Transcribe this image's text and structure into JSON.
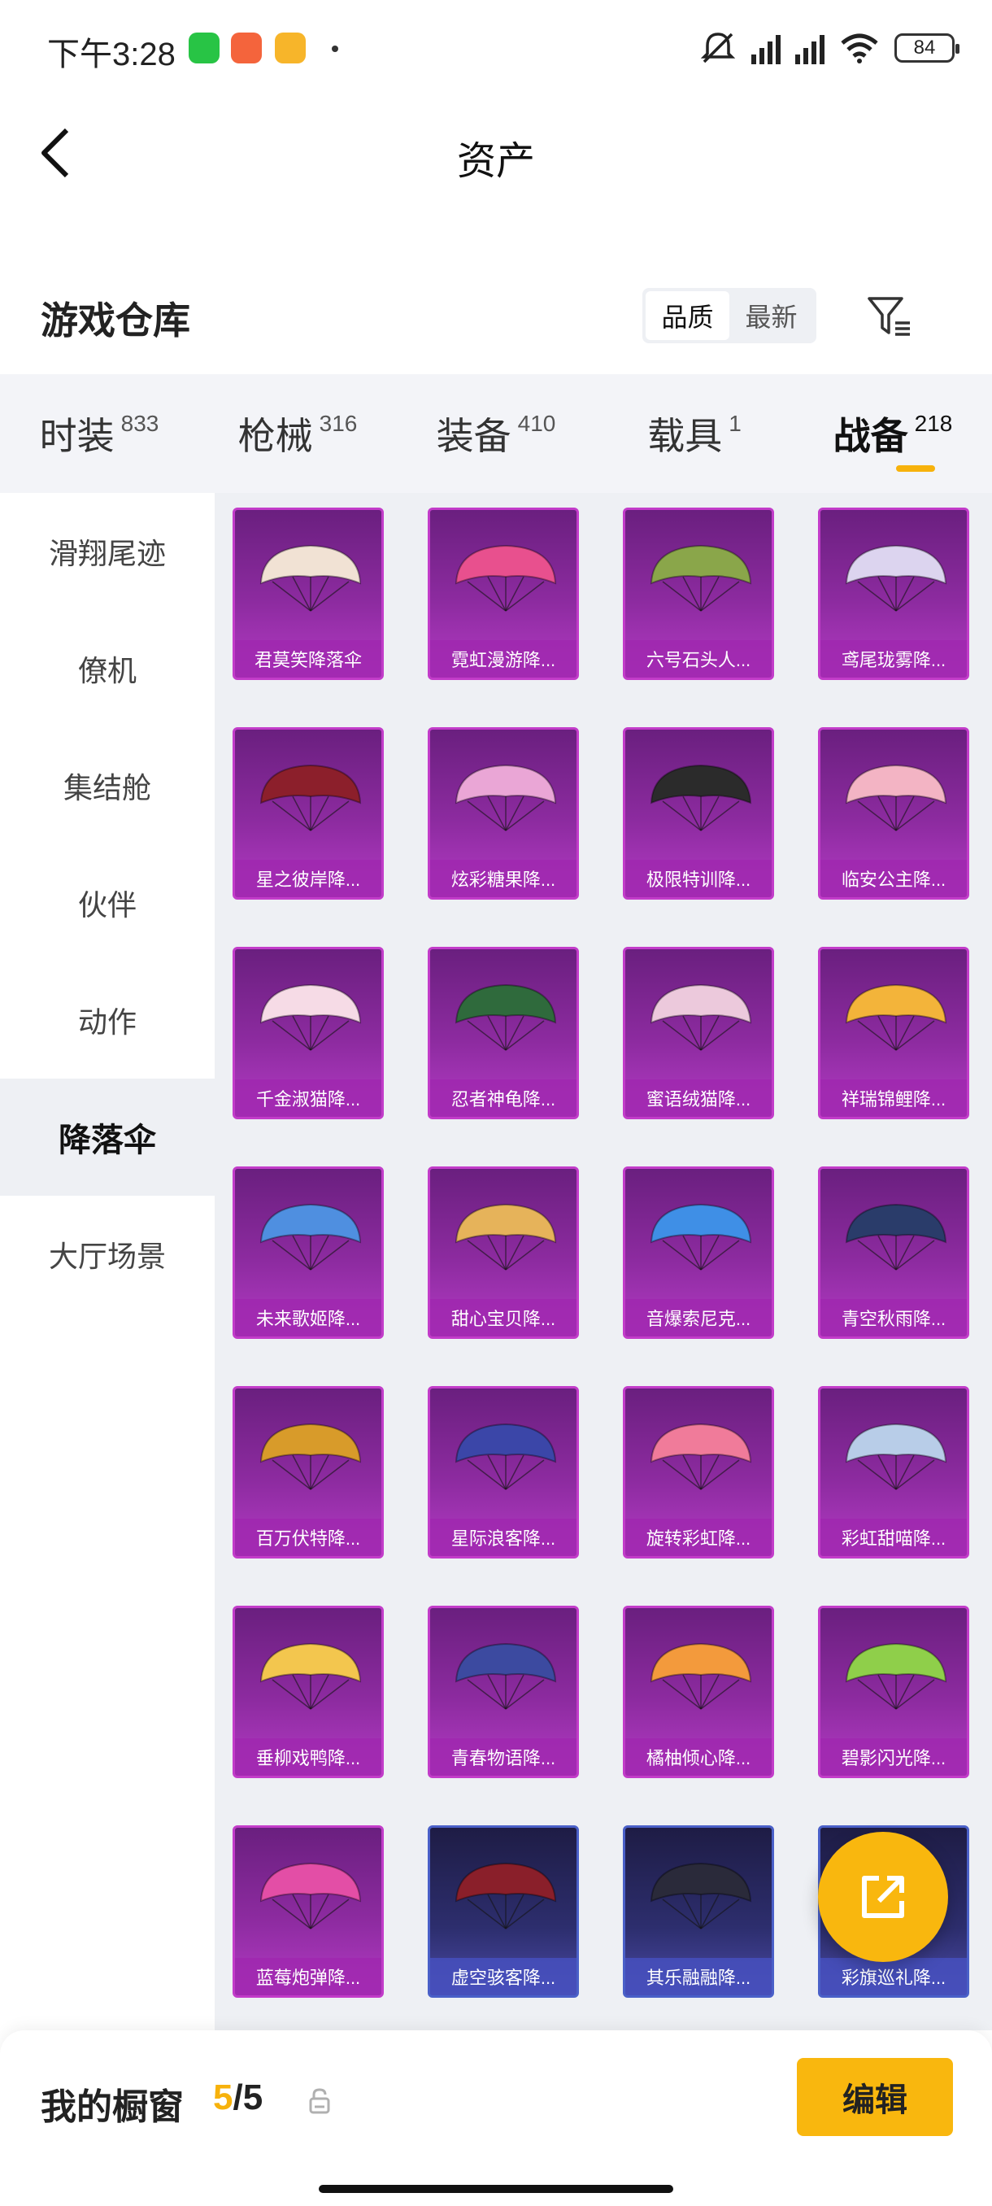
{
  "status_bar": {
    "time": "下午3:28",
    "battery": "84"
  },
  "header": {
    "title": "资产"
  },
  "section": {
    "title": "游戏仓库",
    "sort_options": [
      "品质",
      "最新"
    ],
    "active_sort": "品质"
  },
  "tabs": [
    {
      "label": "时装",
      "count": "833"
    },
    {
      "label": "枪械",
      "count": "316"
    },
    {
      "label": "装备",
      "count": "410"
    },
    {
      "label": "载具",
      "count": "1"
    },
    {
      "label": "战备",
      "count": "218",
      "active": true
    }
  ],
  "sidebar": {
    "items": [
      "滑翔尾迹",
      "僚机",
      "集结舱",
      "伙伴",
      "动作",
      "降落伞",
      "大厅场景"
    ],
    "active": "降落伞"
  },
  "items": [
    {
      "name": "君莫笑降落伞",
      "color": "#f1e2d4",
      "rarity": "purple"
    },
    {
      "name": "霓虹漫游降...",
      "color": "#e8508e",
      "rarity": "purple"
    },
    {
      "name": "六号石头人...",
      "color": "#8aa64a",
      "rarity": "purple"
    },
    {
      "name": "鸢尾珑雾降...",
      "color": "#dcd4ef",
      "rarity": "purple"
    },
    {
      "name": "星之彼岸降...",
      "color": "#8c1f2b",
      "rarity": "purple"
    },
    {
      "name": "炫彩糖果降...",
      "color": "#eaa6d6",
      "rarity": "purple"
    },
    {
      "name": "极限特训降...",
      "color": "#2b2b2b",
      "rarity": "purple"
    },
    {
      "name": "临安公主降...",
      "color": "#f3b4c4",
      "rarity": "purple"
    },
    {
      "name": "千金淑猫降...",
      "color": "#f6dbe6",
      "rarity": "purple"
    },
    {
      "name": "忍者神龟降...",
      "color": "#2f6a3c",
      "rarity": "purple"
    },
    {
      "name": "蜜语绒猫降...",
      "color": "#ecc9dc",
      "rarity": "purple"
    },
    {
      "name": "祥瑞锦鲤降...",
      "color": "#f3b43a",
      "rarity": "purple"
    },
    {
      "name": "未来歌姬降...",
      "color": "#4f8fe0",
      "rarity": "purple"
    },
    {
      "name": "甜心宝贝降...",
      "color": "#e6b35a",
      "rarity": "purple"
    },
    {
      "name": "音爆索尼克...",
      "color": "#3f8fe6",
      "rarity": "purple"
    },
    {
      "name": "青空秋雨降...",
      "color": "#2a3c6a",
      "rarity": "purple"
    },
    {
      "name": "百万伏特降...",
      "color": "#d89b2a",
      "rarity": "purple"
    },
    {
      "name": "星际浪客降...",
      "color": "#3b46a8",
      "rarity": "purple"
    },
    {
      "name": "旋转彩虹降...",
      "color": "#f07b9a",
      "rarity": "purple"
    },
    {
      "name": "彩虹甜喵降...",
      "color": "#b8cde8",
      "rarity": "purple"
    },
    {
      "name": "垂柳戏鸭降...",
      "color": "#f3c64e",
      "rarity": "purple"
    },
    {
      "name": "青春物语降...",
      "color": "#3c4aa0",
      "rarity": "purple"
    },
    {
      "name": "橘柚倾心降...",
      "color": "#f39a3c",
      "rarity": "purple"
    },
    {
      "name": "碧影闪光降...",
      "color": "#8fcf4a",
      "rarity": "purple"
    },
    {
      "name": "蓝莓炮弹降...",
      "color": "#e34ea6",
      "rarity": "purple"
    },
    {
      "name": "虚空骇客降...",
      "color": "#8a1f2a",
      "rarity": "blue"
    },
    {
      "name": "其乐融融降...",
      "color": "#2a2a3a",
      "rarity": "blue"
    },
    {
      "name": "彩旗巡礼降...",
      "color": "#5a5ab0",
      "rarity": "blue"
    }
  ],
  "bottom": {
    "label": "我的橱窗",
    "current": "5",
    "separator": "/",
    "max": "5",
    "edit": "编辑"
  }
}
